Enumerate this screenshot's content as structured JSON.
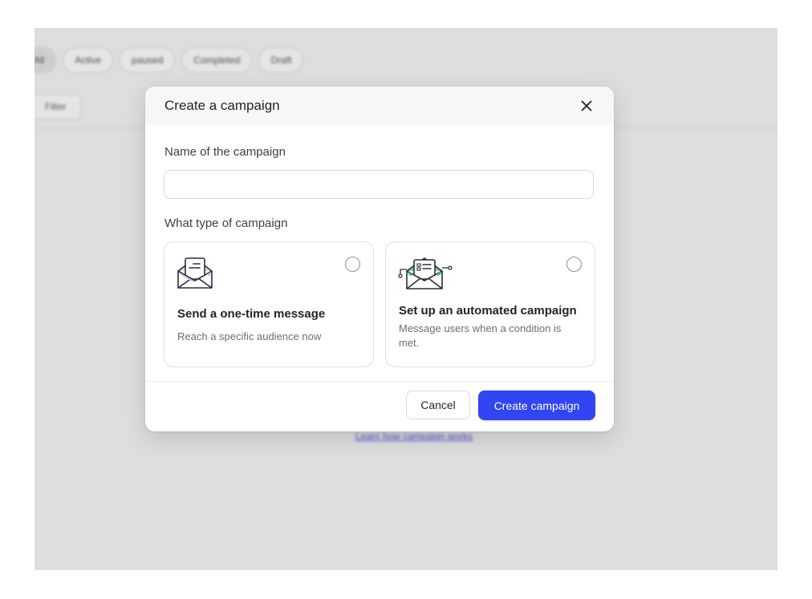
{
  "background": {
    "tabs": [
      {
        "label": "All"
      },
      {
        "label": "Active"
      },
      {
        "label": "paused"
      },
      {
        "label": "Completed"
      },
      {
        "label": "Draft"
      }
    ],
    "filter_label": "Filter",
    "learn_link": "Learn how campaign works"
  },
  "modal": {
    "title": "Create a campaign",
    "close_icon": "close-icon",
    "name_label": "Name of the campaign",
    "name_value": "",
    "name_placeholder": "",
    "type_label": "What type of campaign",
    "options": [
      {
        "icon": "open-envelope-icon",
        "title": "Send a one-time message",
        "description": "Reach a specific audience now",
        "selected": false
      },
      {
        "icon": "automated-envelope-icon",
        "title": "Set up an automated campaign",
        "description": "Message users when a condition is met.",
        "selected": false
      }
    ],
    "cancel_label": "Cancel",
    "create_label": "Create campaign"
  },
  "colors": {
    "primary": "#2f46f2",
    "accent_green": "#3bb77e",
    "accent_purple": "#b9b6f5"
  }
}
